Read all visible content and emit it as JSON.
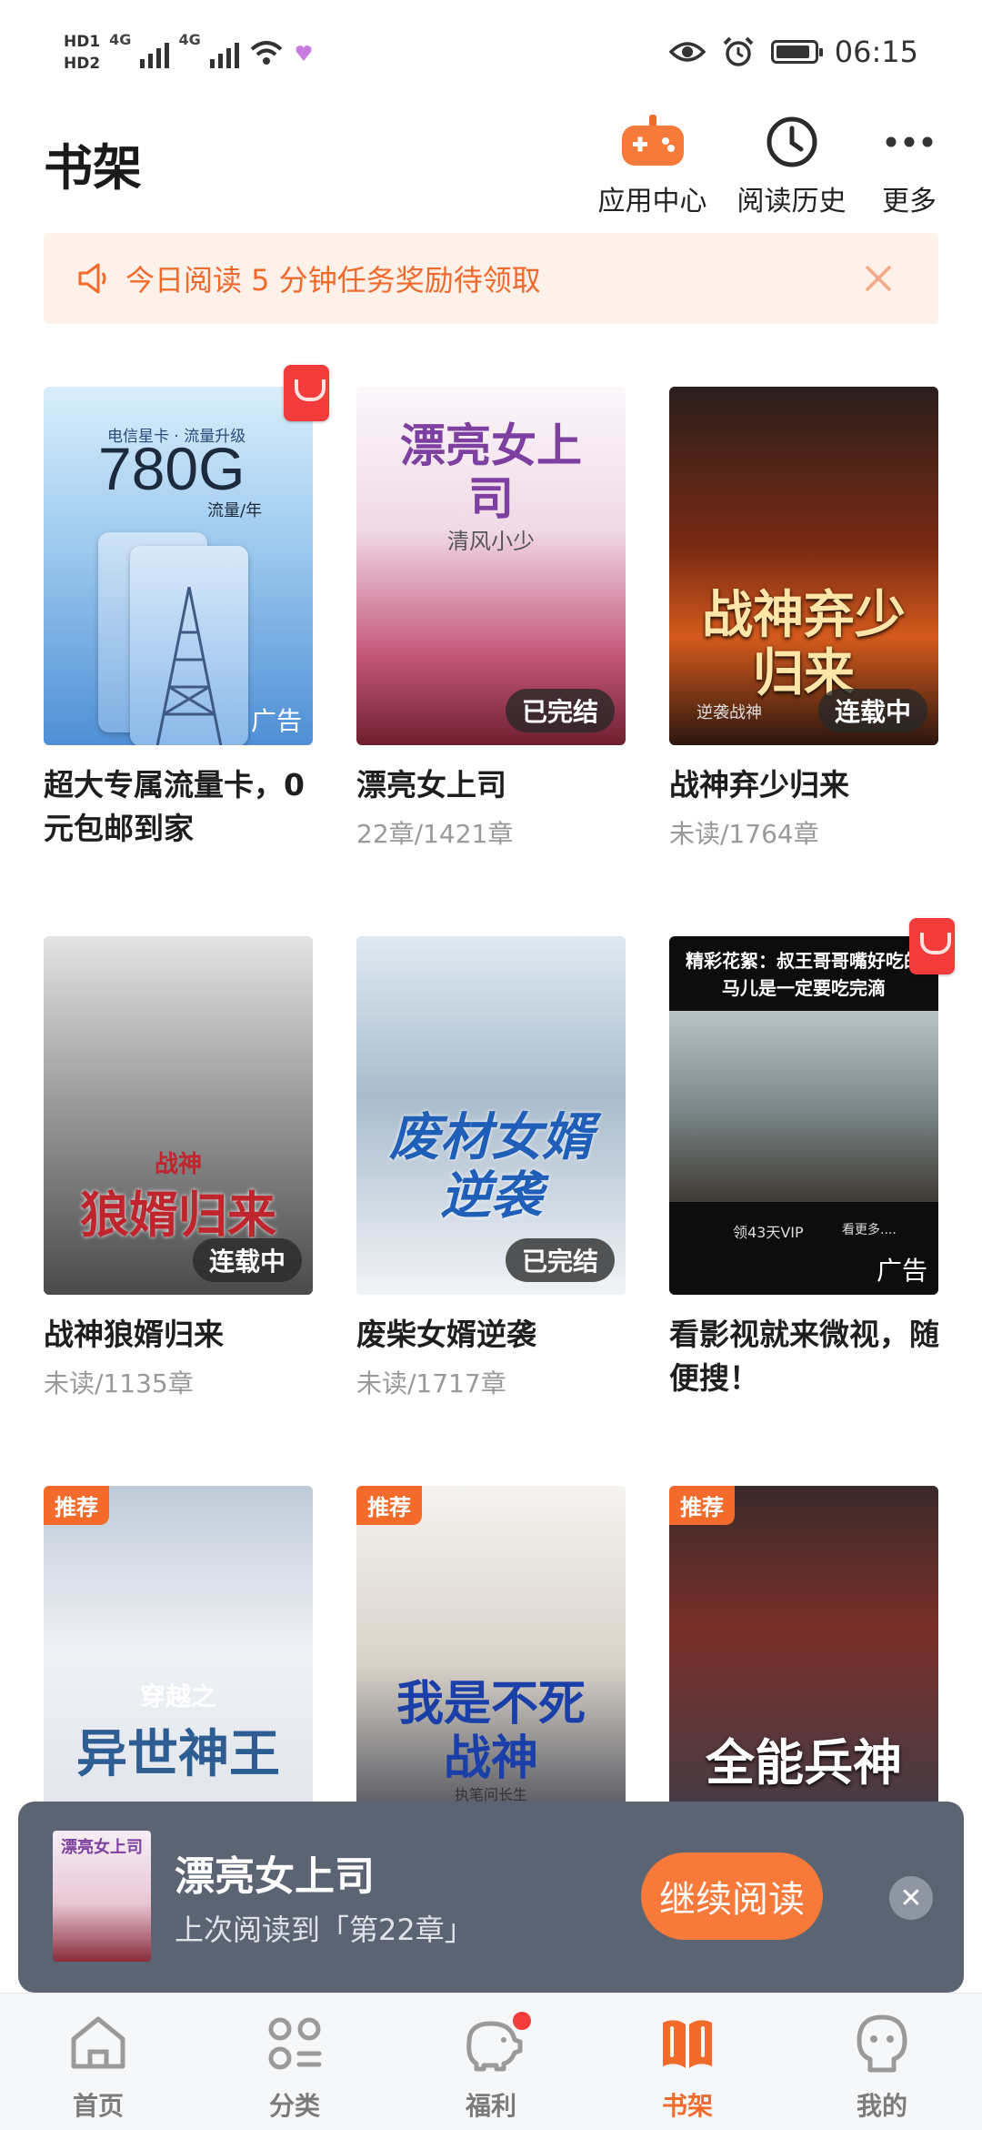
{
  "status_bar": {
    "hd1": "HD1",
    "hd2": "HD2",
    "net1": "4G",
    "net2": "4G",
    "time": "06:15"
  },
  "header": {
    "title": "书架",
    "app_center_label": "应用中心",
    "history_label": "阅读历史",
    "more_label": "更多"
  },
  "notice": {
    "text": "今日阅读 5 分钟任务奖励待领取"
  },
  "books": [
    {
      "title": "超大专属流量卡，0元包邮到家",
      "progress": "",
      "cover_text": "780G",
      "cover_sub": "电信星卡 · 流量升级",
      "cover_extra": "流量/年",
      "ad_label": "广告"
    },
    {
      "title": "漂亮女上司",
      "progress": "22章/1421章",
      "cover_text": "漂亮女上司",
      "cover_sub": "清风小少",
      "status": "已完结"
    },
    {
      "title": "战神弃少归来",
      "progress": "未读/1764章",
      "cover_text": "战神弃少归来",
      "cover_sub": "逆袭战神",
      "status": "连载中"
    },
    {
      "title": "战神狼婿归来",
      "progress": "未读/1135章",
      "cover_text": "狼婿归来",
      "cover_sub": "战神",
      "status": "连载中"
    },
    {
      "title": "废柴女婿逆袭",
      "progress": "未读/1717章",
      "cover_text": "废材女婿逆袭",
      "status": "已完结"
    },
    {
      "title": "看影视就来微视，随便搜！",
      "progress": "",
      "cover_text": "精彩花絮：叔王哥哥嘴好吃的马儿是一定要吃完滴",
      "cover_sub": "领43天VIP",
      "cover_extra": "看更多....",
      "ad_label": "广告"
    },
    {
      "title": "穿越之异世神王",
      "progress": "",
      "cover_text": "异世神王",
      "cover_sub": "穿越之",
      "tag": "推荐"
    },
    {
      "title": "我是不死战神",
      "progress": "",
      "cover_text": "我是不死战神",
      "cover_sub": "执笔问长生",
      "tag": "推荐"
    },
    {
      "title": "全能兵神",
      "progress": "",
      "cover_text": "全能兵神",
      "tag": "推荐"
    }
  ],
  "continue_reading": {
    "title": "漂亮女上司",
    "subtitle": "上次阅读到「第22章」",
    "button_label": "继续阅读",
    "cover_text": "漂亮女上司"
  },
  "bottom_nav": {
    "items": [
      {
        "label": "首页",
        "icon": "home-icon"
      },
      {
        "label": "分类",
        "icon": "category-icon"
      },
      {
        "label": "福利",
        "icon": "piggy-bank-icon"
      },
      {
        "label": "书架",
        "icon": "bookshelf-icon"
      },
      {
        "label": "我的",
        "icon": "profile-icon"
      }
    ],
    "active_index": 3
  },
  "colors": {
    "accent": "#f26b2a",
    "notice_bg": "#fdf1ea",
    "continue_bar_bg": "#5a6472"
  }
}
